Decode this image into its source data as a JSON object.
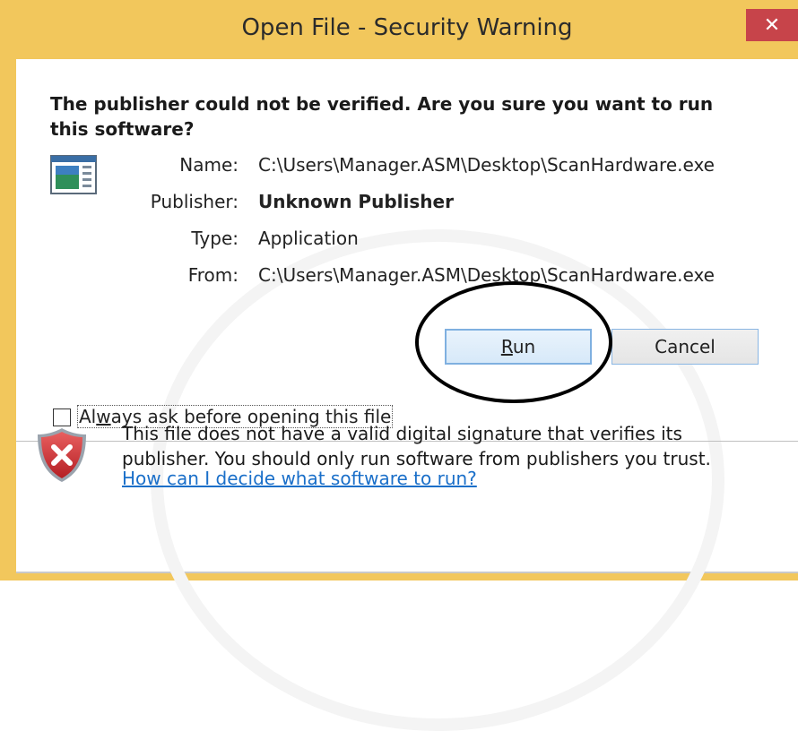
{
  "window": {
    "title": "Open File - Security Warning",
    "close_glyph": "✕"
  },
  "heading": "The publisher could not be verified.  Are you sure you want to run this software?",
  "app_icon": "application-icon",
  "fields": {
    "name_label": "Name:",
    "name_value": "C:\\Users\\Manager.ASM\\Desktop\\ScanHardware.exe",
    "publisher_label": "Publisher:",
    "publisher_value": "Unknown Publisher",
    "type_label": "Type:",
    "type_value": "Application",
    "from_label": "From:",
    "from_value": "C:\\Users\\Manager.ASM\\Desktop\\ScanHardware.exe"
  },
  "buttons": {
    "run_prefix": "R",
    "run_rest": "un",
    "cancel": "Cancel"
  },
  "checkbox": {
    "label_prefix": "Al",
    "label_underlined": "w",
    "label_rest": "ays ask before opening this file",
    "checked": false
  },
  "warning": {
    "icon": "shield-error-icon",
    "text": "This file does not have a valid digital signature that verifies its publisher.  You should only run software from publishers you trust.",
    "link": "How can I decide what software to run?"
  },
  "colors": {
    "title_bar": "#f2c75c",
    "close_button": "#c7444a",
    "link": "#1a6fc9"
  }
}
